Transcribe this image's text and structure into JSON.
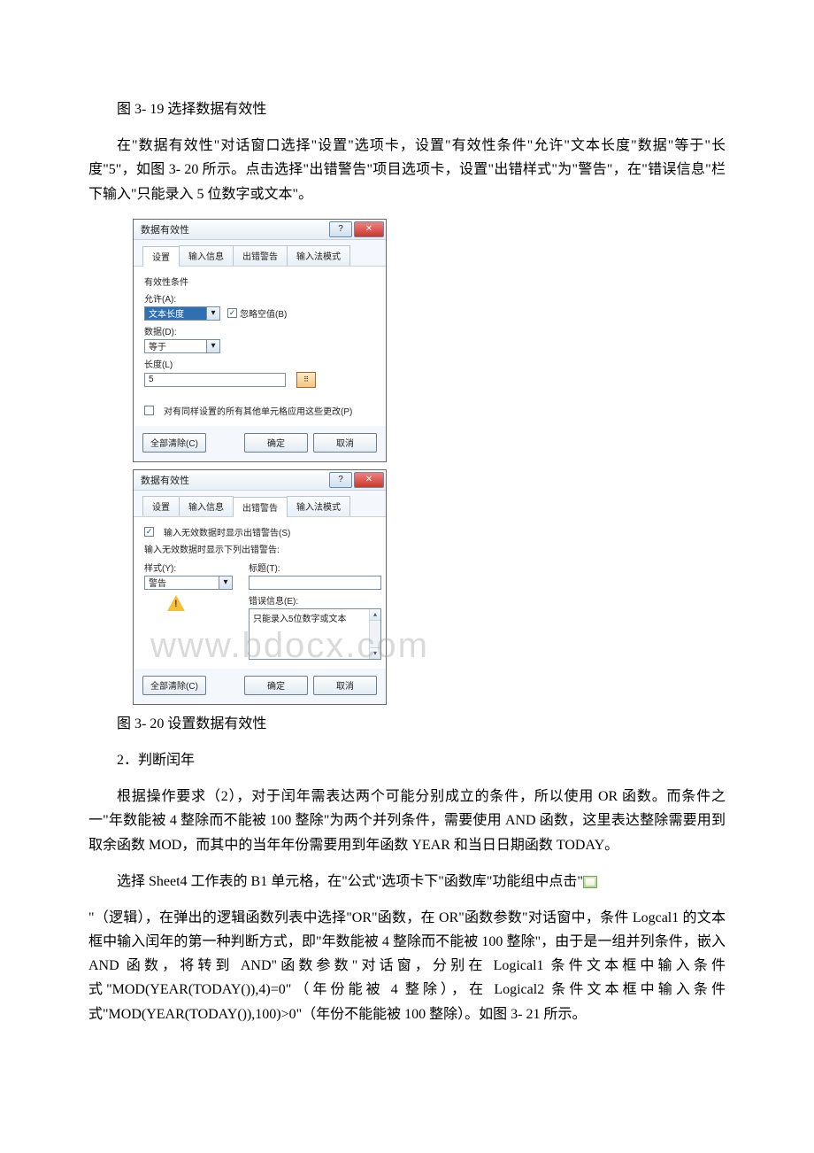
{
  "caption1": "图 3- 19 选择数据有效性",
  "para1": "在\"数据有效性\"对话窗口选择\"设置\"选项卡，设置\"有效性条件\"允许\"文本长度\"数据\"等于\"长度\"5\"，如图 3- 20 所示。点击选择\"出错警告\"项目选项卡，设置\"出错样式\"为\"警告\"，在\"错误信息\"栏下输入\"只能录入 5 位数字或文本\"。",
  "dialog1": {
    "title": "数据有效性",
    "tabs": {
      "t1": "设置",
      "t2": "输入信息",
      "t3": "出错警告",
      "t4": "输入法模式"
    },
    "groupTitle": "有效性条件",
    "allowLabel": "允许(A):",
    "allowValue": "文本长度",
    "ignoreBlank": "忽略空值(B)",
    "dataLabel": "数据(D):",
    "dataValue": "等于",
    "lenLabel": "长度(L)",
    "lenValue": "5",
    "applyAll": "对有同样设置的所有其他单元格应用这些更改(P)",
    "clearAll": "全部清除(C)",
    "ok": "确定",
    "cancel": "取消"
  },
  "dialog2": {
    "title": "数据有效性",
    "tabs": {
      "t1": "设置",
      "t2": "输入信息",
      "t3": "出错警告",
      "t4": "输入法模式"
    },
    "showOnInvalid": "输入无效数据时显示出错警告(S)",
    "groupTitle": "输入无效数据时显示下列出错警告:",
    "styleLabel": "样式(Y):",
    "styleValue": "警告",
    "titleLabel": "标题(T):",
    "msgLabel": "错误信息(E):",
    "msgValue": "只能录入5位数字或文本",
    "clearAll": "全部清除(C)",
    "ok": "确定",
    "cancel": "取消"
  },
  "caption2": "图 3- 20 设置数据有效性",
  "heading2": "2．判断闰年",
  "para2": "根据操作要求（2），对于闰年需表达两个可能分别成立的条件，所以使用 OR 函数。而条件之一\"年数能被 4 整除而不能被 100 整除\"为两个并列条件，需要使用 AND 函数，这里表达整除需要用到取余函数 MOD，而其中的当年年份需要用到年函数 YEAR 和当日日期函数 TODAY。",
  "para3a": "选择 Sheet4 工作表的 B1 单元格，在\"公式\"选项卡下\"函数库\"功能组中点击\"",
  "para4": "\"（逻辑），在弹出的逻辑函数列表中选择\"OR\"函数，在 OR\"函数参数\"对话窗中，条件 Logcal1 的文本框中输入闰年的第一种判断方式，即\"年数能被 4 整除而不能被 100 整除\"，由于是一组并列条件，嵌入 AND 函数，将转到 AND\"函数参数\"对话窗，分别在 Logical1 条件文本框中输入条件式\"MOD(YEAR(TODAY()),4)=0\"（年份能被 4 整除），在 Logical2 条件文本框中输入条件式\"MOD(YEAR(TODAY()),100)>0\"（年份不能能被 100 整除）。如图 3- 21 所示。",
  "watermark": "www.bdocx.com"
}
